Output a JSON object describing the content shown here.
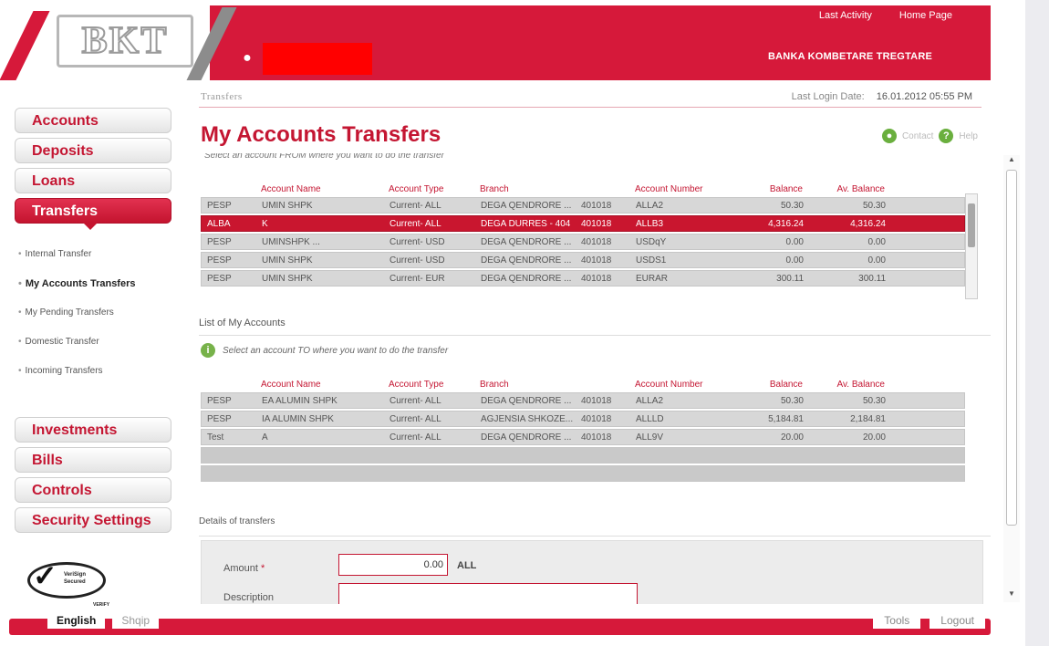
{
  "header": {
    "logo_text": "BKT",
    "top_links": [
      "Last Activity",
      "Home Page"
    ],
    "bank_name": "BANKA KOMBETARE TREGTARE"
  },
  "sidebar": {
    "top_items": [
      "Accounts",
      "Deposits",
      "Loans",
      "Transfers"
    ],
    "active": "Transfers",
    "sub_items": [
      "Internal Transfer",
      "My Accounts Transfers",
      "My Pending Transfers",
      "Domestic Transfer",
      "Incoming Transfers"
    ],
    "active_sub": "My Accounts Transfers",
    "bottom_items": [
      "Investments",
      "Bills",
      "Controls",
      "Security Settings"
    ]
  },
  "badge": {
    "text": "VeriSign Secured",
    "verify": "VERIFY"
  },
  "main": {
    "breadcrumb": "Transfers",
    "last_login_label": "Last Login Date:",
    "last_login_value": "16.01.2012 05:55 PM",
    "title": "My Accounts Transfers",
    "contact_label": "Contact",
    "help_label": "Help",
    "hint_from": "Select an account FROM where you want to do the transfer",
    "list_heading": "List of My Accounts",
    "hint_to": "Select an account TO where you want to do the transfer",
    "details_heading": "Details of transfers",
    "amount_label": "Amount",
    "amount_required": "*",
    "amount_value": "0.00",
    "amount_currency": "ALL",
    "description_label": "Description"
  },
  "columns": [
    "Account Name",
    "Account Type",
    "Branch",
    "Account Number",
    "Balance",
    "Av. Balance"
  ],
  "from_accounts": [
    {
      "ind": "PESP",
      "name": "UMIN SHPK",
      "type": "Current- ALL",
      "branch": "DEGA QENDRORE ...",
      "acct": "401018",
      "suffix": "ALLA2",
      "balance": "50.30",
      "av_balance": "50.30"
    },
    {
      "ind": "ALBA",
      "name": "K",
      "type": "Current- ALL",
      "branch": "DEGA DURRES - 404",
      "acct": "401018",
      "suffix": "ALLB3",
      "balance": "4,316.24",
      "av_balance": "4,316.24"
    },
    {
      "ind": "PESP",
      "name": "UMINSHPK ...",
      "type": "Current- USD",
      "branch": "DEGA QENDRORE ...",
      "acct": "401018",
      "suffix": "USDqY",
      "balance": "0.00",
      "av_balance": "0.00"
    },
    {
      "ind": "PESP",
      "name": "UMIN SHPK",
      "type": "Current- USD",
      "branch": "DEGA QENDRORE ...",
      "acct": "401018",
      "suffix": "USDS1",
      "balance": "0.00",
      "av_balance": "0.00"
    },
    {
      "ind": "PESP",
      "name": "UMIN SHPK",
      "type": "Current- EUR",
      "branch": "DEGA QENDRORE ...",
      "acct": "401018",
      "suffix": "EURAR",
      "balance": "300.11",
      "av_balance": "300.11"
    }
  ],
  "to_accounts": [
    {
      "ind": "PESP",
      "name": "EA ALUMIN SHPK",
      "type": "Current- ALL",
      "branch": "DEGA QENDRORE ...",
      "acct": "401018",
      "suffix": "ALLA2",
      "balance": "50.30",
      "av_balance": "50.30"
    },
    {
      "ind": "PESP",
      "name": "IA ALUMIN SHPK",
      "type": "Current- ALL",
      "branch": "AGJENSIA SHKOZE...",
      "acct": "401018",
      "suffix": "ALLLD",
      "balance": "5,184.81",
      "av_balance": "2,184.81"
    },
    {
      "ind": "Test",
      "name": "A",
      "type": "Current- ALL",
      "branch": "DEGA QENDRORE ...",
      "acct": "401018",
      "suffix": "ALL9V",
      "balance": "20.00",
      "av_balance": "20.00"
    }
  ],
  "footer": {
    "languages": [
      "English",
      "Shqip"
    ],
    "active_language": "English",
    "tools": "Tools",
    "logout": "Logout"
  },
  "colors": {
    "brand_red": "#d6193a",
    "selected_row": "#c9162f"
  }
}
